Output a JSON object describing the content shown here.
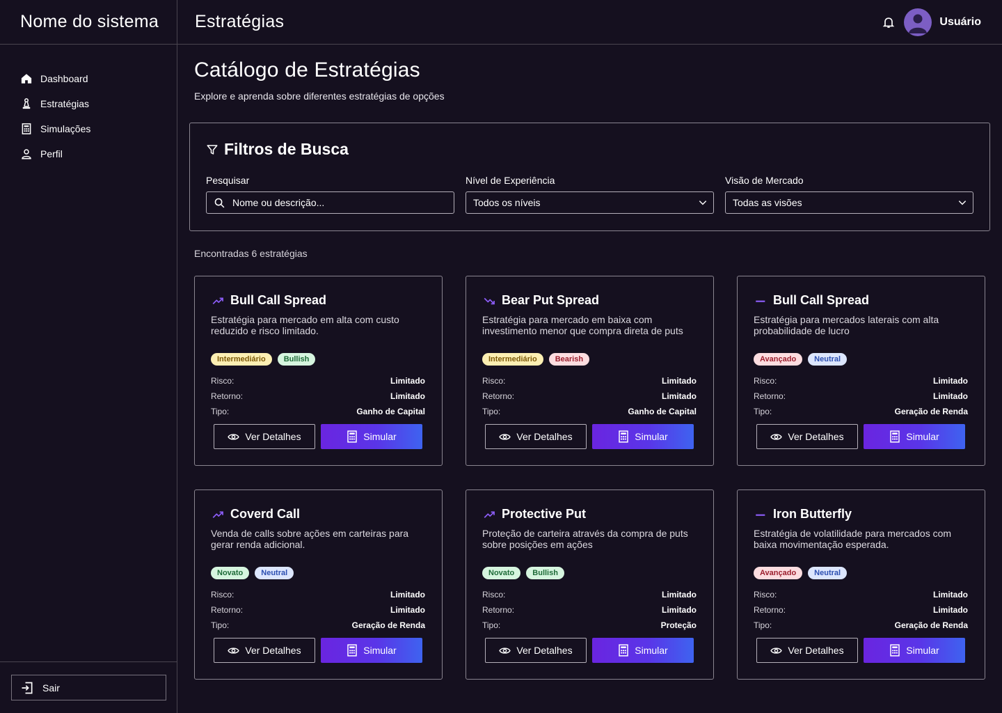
{
  "app": {
    "name": "Nome do sistema"
  },
  "sidebar": {
    "items": [
      {
        "label": "Dashboard",
        "icon": "home-icon"
      },
      {
        "label": "Estratégias",
        "icon": "chess-pawn-icon"
      },
      {
        "label": "Simulações",
        "icon": "calculator-icon"
      },
      {
        "label": "Perfil",
        "icon": "user-icon"
      }
    ],
    "logout_label": "Sair"
  },
  "header": {
    "title": "Estratégias",
    "user_name": "Usuário"
  },
  "page": {
    "title": "Catálogo de Estratégias",
    "subtitle": "Explore e aprenda sobre diferentes estratégias de opções"
  },
  "filters": {
    "title": "Filtros de Busca",
    "search": {
      "label": "Pesquisar",
      "placeholder": "Nome ou descrição..."
    },
    "level": {
      "label": "Nível de Experiência",
      "value": "Todos os níveis"
    },
    "market": {
      "label": "Visão de Mercado",
      "value": "Todas as visões"
    }
  },
  "results": {
    "count_text": "Encontradas 6 estratégias"
  },
  "labels": {
    "risk": "Risco:",
    "return": "Retorno:",
    "type": "Tipo:",
    "details_button": "Ver Detalhes",
    "simulate_button": "Simular"
  },
  "colors": {
    "accent": "#8b5cf6",
    "background": "#15101f"
  },
  "cards": [
    {
      "icon": "trending-up-icon",
      "title": "Bull Call Spread",
      "description": "Estratégia para mercado em alta com custo reduzido e risco limitado.",
      "level": "Intermediário",
      "level_class": "b-inter",
      "market": "Bullish",
      "market_class": "b-bull",
      "risk": "Limitado",
      "return": "Limitado",
      "type": "Ganho de Capital"
    },
    {
      "icon": "trending-down-icon",
      "title": "Bear Put Spread",
      "description": "Estratégia para mercado em baixa com investimento menor que compra direta de puts",
      "level": "Intermediário",
      "level_class": "b-inter",
      "market": "Bearish",
      "market_class": "b-bear",
      "risk": "Limitado",
      "return": "Limitado",
      "type": "Ganho de Capital"
    },
    {
      "icon": "minus-icon",
      "title": "Bull Call Spread",
      "description": "Estratégia para mercados laterais com alta probabilidade de lucro",
      "level": "Avançado",
      "level_class": "b-adv",
      "market": "Neutral",
      "market_class": "b-neu",
      "risk": "Limitado",
      "return": "Limitado",
      "type": "Geração de Renda"
    },
    {
      "icon": "trending-up-icon",
      "title": "Coverd Call",
      "description": "Venda de calls sobre ações em carteiras para gerar renda adicional.",
      "level": "Novato",
      "level_class": "b-nov",
      "market": "Neutral",
      "market_class": "b-neu",
      "risk": "Limitado",
      "return": "Limitado",
      "type": "Geração de Renda"
    },
    {
      "icon": "trending-up-icon",
      "title": "Protective Put",
      "description": "Proteção de carteira através da compra de puts sobre posições em ações",
      "level": "Novato",
      "level_class": "b-nov",
      "market": "Bullish",
      "market_class": "b-bull",
      "risk": "Limitado",
      "return": "Limitado",
      "type": "Proteção"
    },
    {
      "icon": "minus-icon",
      "title": "Iron Butterfly",
      "description": "Estratégia de volatilidade para mercados com baixa movimentação esperada.",
      "level": "Avançado",
      "level_class": "b-adv",
      "market": "Neutral",
      "market_class": "b-neu",
      "risk": "Limitado",
      "return": "Limitado",
      "type": "Geração de Renda"
    }
  ]
}
